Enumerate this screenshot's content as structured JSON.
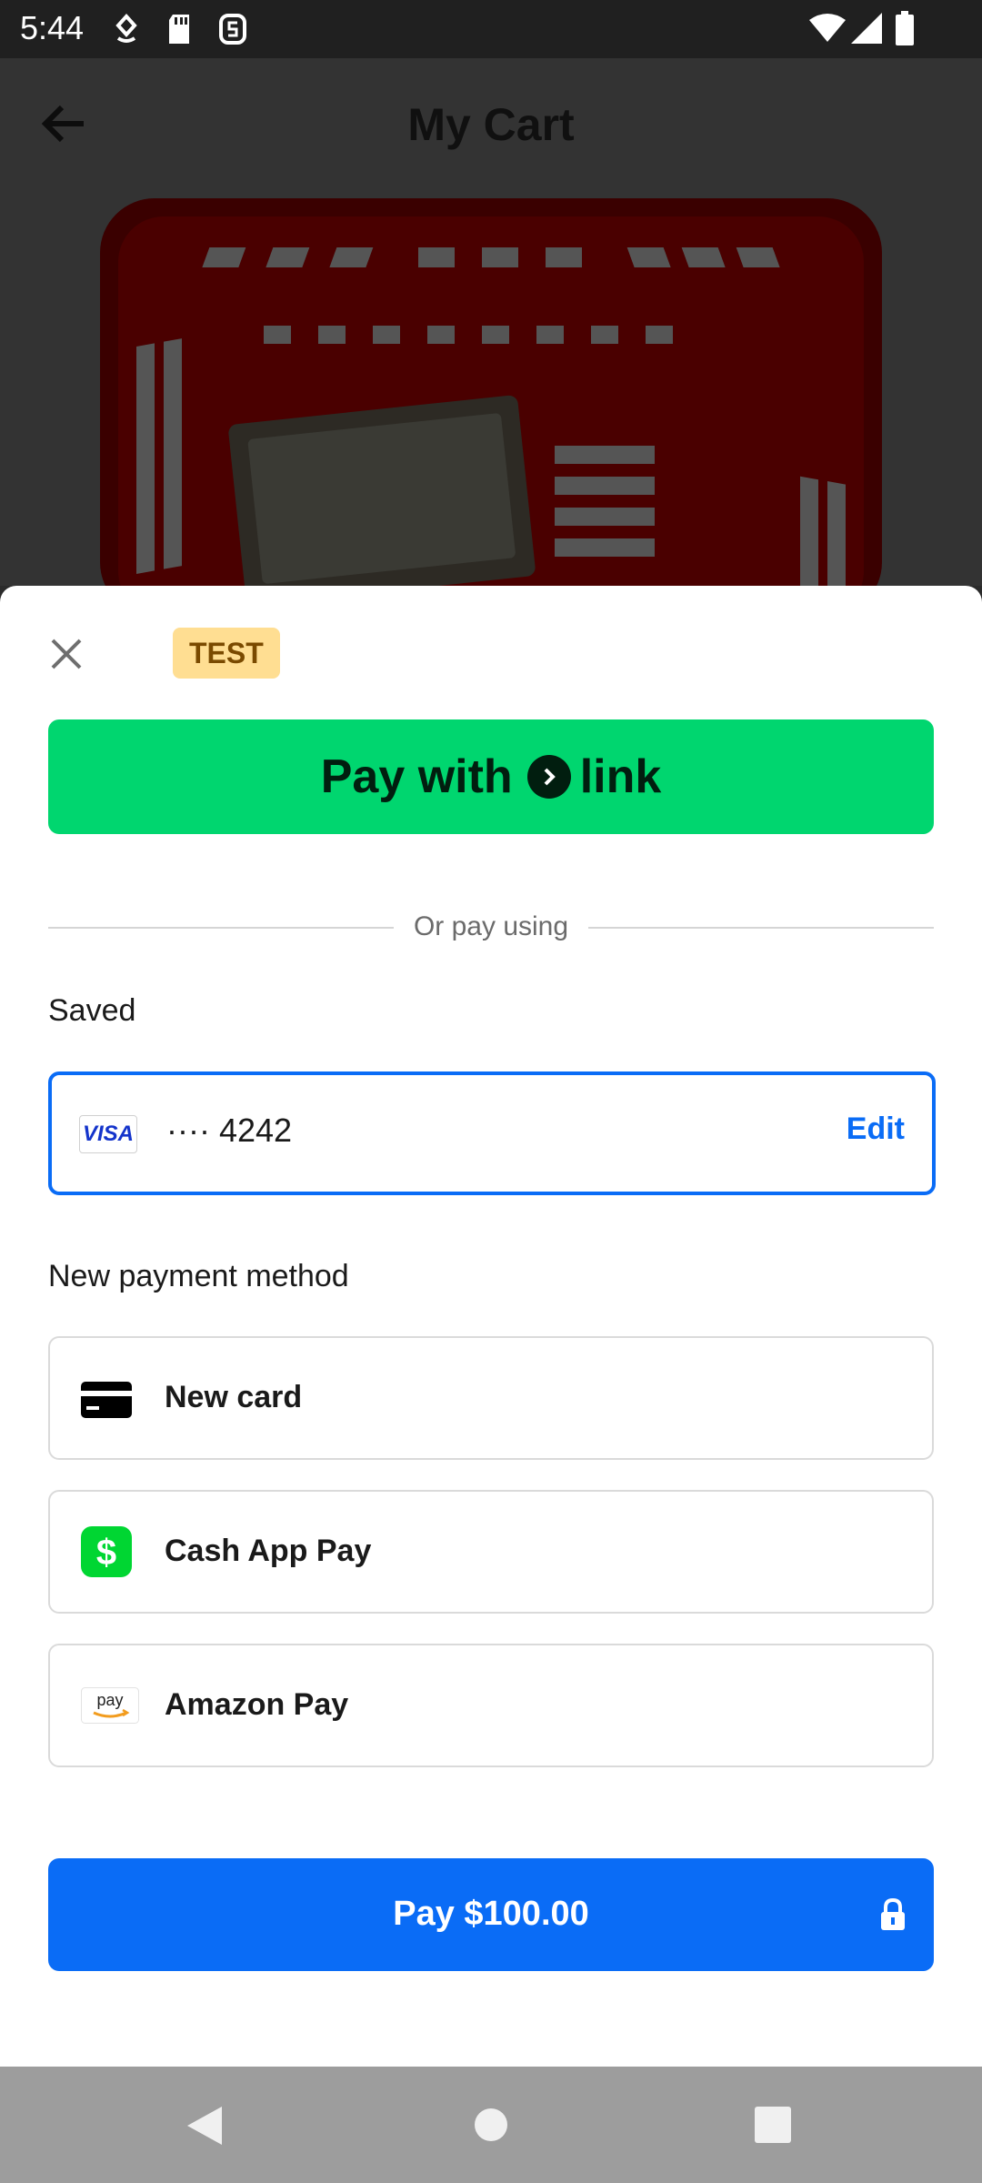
{
  "status_bar": {
    "time": "5:44",
    "left_icons": [
      "diamond-hand-icon",
      "sd-card-icon",
      "sync-s-icon"
    ],
    "right_icons": [
      "wifi-icon",
      "signal-icon",
      "battery-icon"
    ]
  },
  "app": {
    "title": "My Cart",
    "back_icon": "arrow-left-icon"
  },
  "sheet": {
    "test_badge": "TEST",
    "link_button": {
      "prefix": "Pay with",
      "brand": "link"
    },
    "divider_text": "Or pay using",
    "saved_section_label": "Saved",
    "saved_card": {
      "brand": "VISA",
      "number": "···· 4242",
      "edit_label": "Edit"
    },
    "new_method_section_label": "New payment method",
    "methods": [
      {
        "label": "New card",
        "icon": "credit-card-icon"
      },
      {
        "label": "Cash App Pay",
        "icon": "cash-app-icon"
      },
      {
        "label": "Amazon Pay",
        "icon": "amazon-pay-icon",
        "icon_text": "pay"
      }
    ],
    "pay_button": "Pay $100.00"
  },
  "colors": {
    "link_green": "#00d66f",
    "accent_blue": "#0a6cf6",
    "test_badge_bg": "#ffde92",
    "cash_app_green": "#00d632"
  }
}
